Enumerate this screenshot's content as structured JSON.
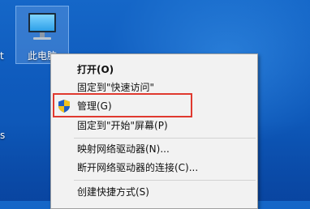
{
  "desktop": {
    "icon_label": "此电脑",
    "icon_name": "computer-monitor-icon",
    "edge_text_1": "t",
    "edge_text_2": "s"
  },
  "context_menu": {
    "items": [
      {
        "label": "打开(O)",
        "bold": true
      },
      {
        "label": "固定到\"快速访问\""
      },
      {
        "label": "管理(G)",
        "icon": "uac-shield-icon",
        "highlighted": true
      },
      {
        "label": "固定到\"开始\"屏幕(P)"
      },
      {
        "label": "映射网络驱动器(N)..."
      },
      {
        "label": "断开网络驱动器的连接(C)..."
      },
      {
        "label": "创建快捷方式(S)"
      }
    ]
  },
  "colors": {
    "highlight_border": "#e0392f",
    "desktop_blue": "#1567c8",
    "menu_background": "#f2f2f2"
  }
}
